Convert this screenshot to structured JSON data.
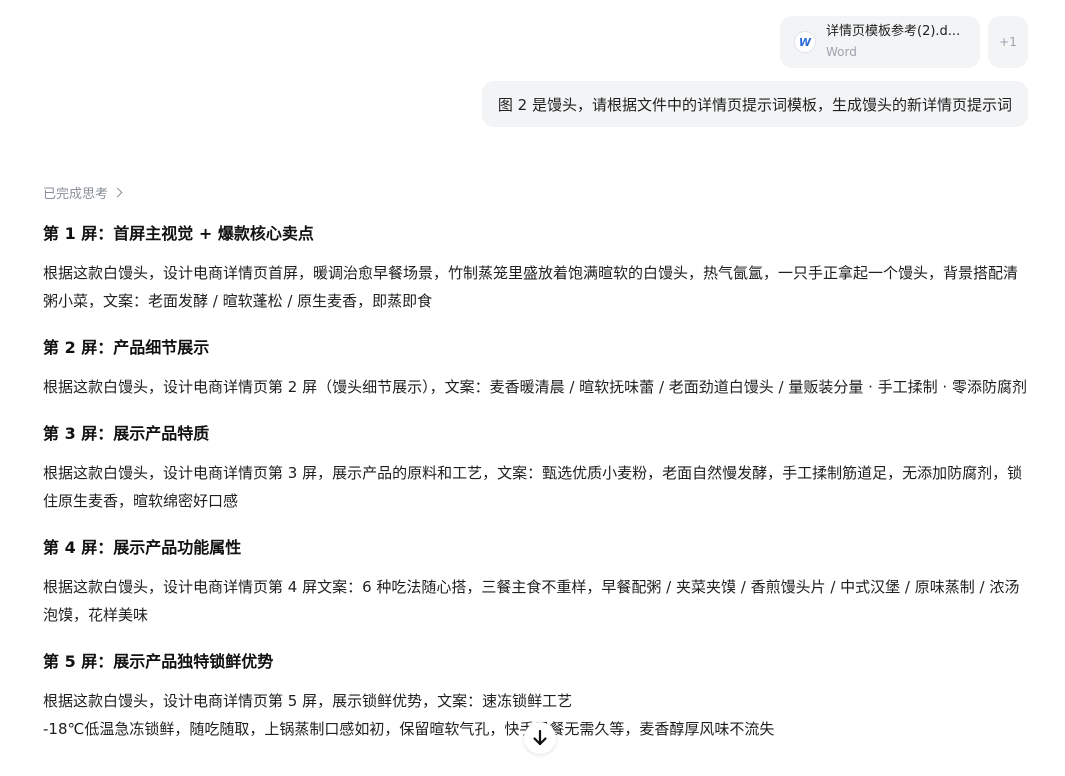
{
  "attachment": {
    "file_name": "详情页模板参考(2).d...",
    "file_type": "Word",
    "icon": "word-icon",
    "more_label": "+1"
  },
  "user_message": "图 2 是馒头，请根据文件中的详情页提示词模板，生成馒头的新详情页提示词",
  "thinking_label": "已完成思考",
  "sections": [
    {
      "title": "第 1 屏：首屏主视觉 + 爆款核心卖点",
      "body": "根据这款白馒头，设计电商详情页首屏，暖调治愈早餐场景，竹制蒸笼里盛放着饱满暄软的白馒头，热气氤氲，一只手正拿起一个馒头，背景搭配清粥小菜，文案：老面发酵 / 暄软蓬松 / 原生麦香，即蒸即食"
    },
    {
      "title": "第 2 屏：产品细节展示",
      "body": "根据这款白馒头，设计电商详情页第 2 屏（馒头细节展示），文案：麦香暖清晨 / 暄软抚味蕾 / 老面劲道白馒头 / 量贩装分量 · 手工揉制 · 零添防腐剂"
    },
    {
      "title": "第 3 屏：展示产品特质",
      "body": "根据这款白馒头，设计电商详情页第 3 屏，展示产品的原料和工艺，文案：甄选优质小麦粉，老面自然慢发酵，手工揉制筋道足，无添加防腐剂，锁住原生麦香，暄软绵密好口感"
    },
    {
      "title": "第 4 屏：展示产品功能属性",
      "body": "根据这款白馒头，设计电商详情页第 4 屏文案：6 种吃法随心搭，三餐主食不重样，早餐配粥 / 夹菜夹馍 / 香煎馒头片 / 中式汉堡 / 原味蒸制 / 浓汤泡馍，花样美味"
    },
    {
      "title": "第 5 屏：展示产品独特锁鲜优势",
      "body": "根据这款白馒头，设计电商详情页第 5 屏，展示锁鲜优势，文案：速冻锁鲜工艺",
      "body2": "-18℃低温急冻锁鲜，随吃随取，上锅蒸制口感如初，保留暄软气孔，快手早餐无需久等，麦香醇厚风味不流失"
    }
  ]
}
